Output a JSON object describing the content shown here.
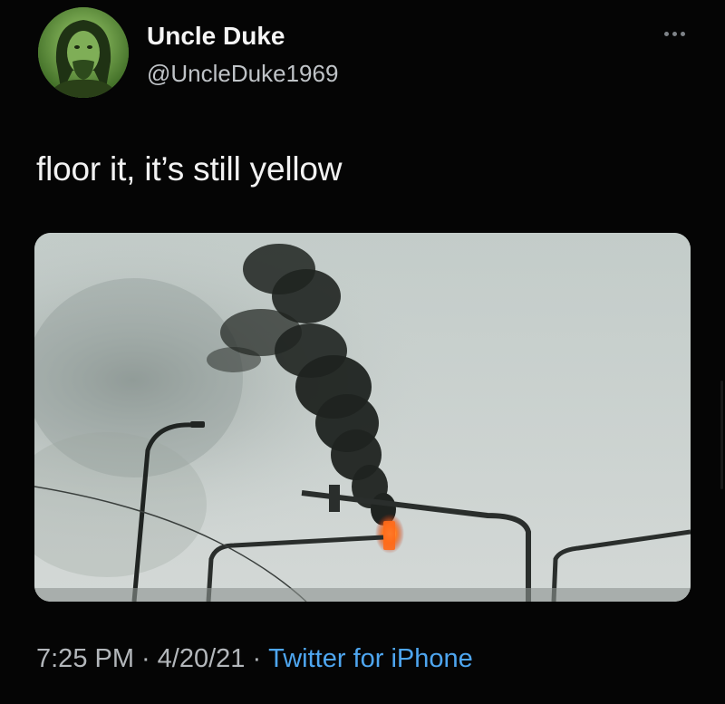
{
  "tweet": {
    "author": {
      "display_name": "Uncle Duke",
      "handle": "@UncleDuke1969",
      "avatar": "profile-photo-green-tint"
    },
    "more_icon": "ellipsis-icon",
    "text": "floor it, it’s still yellow",
    "media": {
      "description_icon": "photo",
      "colors": {
        "sky": "#c7cfcc",
        "smoke": "#1f2320",
        "fire": "#ff6a1a"
      }
    },
    "meta": {
      "time": "7:25 PM",
      "separator": "·",
      "date": "4/20/21",
      "source": "Twitter for iPhone"
    }
  },
  "colors": {
    "background": "#050505",
    "link": "#4ea6f0",
    "text": "#f2f2f2",
    "secondary": "#b3b7bb"
  }
}
